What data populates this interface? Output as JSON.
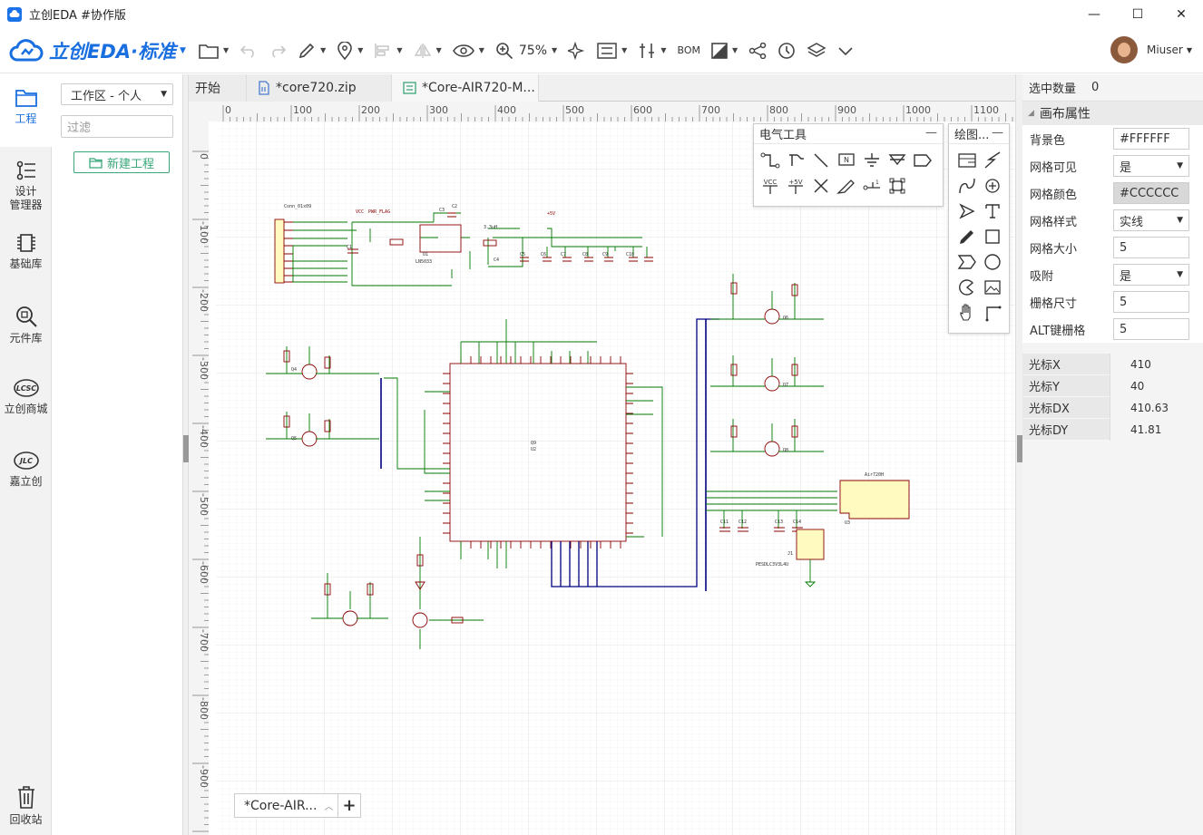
{
  "window": {
    "title": "立创EDA #协作版",
    "minimize": "—",
    "maximize": "☐",
    "close": "✕"
  },
  "toolbar": {
    "brand": "立创EDA·标准",
    "zoom": "75%",
    "bom": "BOM",
    "user": "Miuser"
  },
  "leftnav": [
    {
      "label": "工程",
      "icon": "folder-icon"
    },
    {
      "label": "设计\n管理器",
      "icon": "design-manager-icon"
    },
    {
      "label": "基础库",
      "icon": "chip-icon"
    },
    {
      "label": "元件库",
      "icon": "search-icon"
    },
    {
      "label": "立创商城",
      "icon": "lcsc-icon"
    },
    {
      "label": "嘉立创",
      "icon": "jlc-icon"
    }
  ],
  "recycle": {
    "label": "回收站"
  },
  "project_panel": {
    "workspace": "工作区 - 个人",
    "filter_placeholder": "过滤",
    "new_project": "新建工程"
  },
  "tabs": [
    {
      "label": "开始"
    },
    {
      "label": "*core720.zip"
    },
    {
      "label": "*Core-AIR720-M..."
    }
  ],
  "doc_tab": {
    "label": "*Core-AIR...",
    "add": "+"
  },
  "electrical_tools": {
    "title": "电气工具",
    "minimize": "—"
  },
  "drawing_tools": {
    "title": "绘图...",
    "minimize": "—"
  },
  "right_panel": {
    "selected_count_label": "选中数量",
    "selected_count": "0",
    "section": "画布属性",
    "props": [
      {
        "label": "背景色",
        "value": "#FFFFFF",
        "type": "input"
      },
      {
        "label": "网格可见",
        "value": "是",
        "type": "select"
      },
      {
        "label": "网格颜色",
        "value": "#CCCCCC",
        "type": "input-gray"
      },
      {
        "label": "网格样式",
        "value": "实线",
        "type": "select"
      },
      {
        "label": "网格大小",
        "value": "5",
        "type": "input"
      },
      {
        "label": "吸附",
        "value": "是",
        "type": "select"
      },
      {
        "label": "栅格尺寸",
        "value": "5",
        "type": "input"
      },
      {
        "label": "ALT键栅格",
        "value": "5",
        "type": "input"
      }
    ],
    "cursor": [
      {
        "label": "光标X",
        "value": "410"
      },
      {
        "label": "光标Y",
        "value": "40"
      },
      {
        "label": "光标DX",
        "value": "410.63"
      },
      {
        "label": "光标DY",
        "value": "41.81"
      }
    ]
  },
  "ruler": {
    "x_ticks": [
      "0",
      "100",
      "200",
      "300",
      "400",
      "500",
      "600",
      "700",
      "800",
      "900",
      "1000",
      "1100"
    ],
    "y_ticks": [
      "0",
      "-100",
      "-200",
      "-300",
      "-400",
      "-500",
      "-600",
      "-700",
      "-800",
      "-900"
    ]
  },
  "schematic": {
    "labels": [
      "Conn_01x09",
      "VCC",
      "PWR_FLAG",
      "C2",
      "U1",
      "LN5033",
      "3.3uH",
      "+5V",
      "C1",
      "C3",
      "C4",
      "C5",
      "C6",
      "C7",
      "C8",
      "C9",
      "C10",
      "C11",
      "C12",
      "C13",
      "C14",
      "Q4",
      "Q5",
      "Q6",
      "Q7",
      "Q8",
      "Q9",
      "U2",
      "Air720H",
      "U3",
      "J1",
      "SIM_Card_7pin",
      "PESDLC3V3L4U"
    ],
    "colors": {
      "wire": "#007a00",
      "bus": "#000080",
      "component": "#8b0000",
      "grid": "#e4e4e4",
      "pin": "#0000aa",
      "fill": "#fffbc0"
    }
  }
}
